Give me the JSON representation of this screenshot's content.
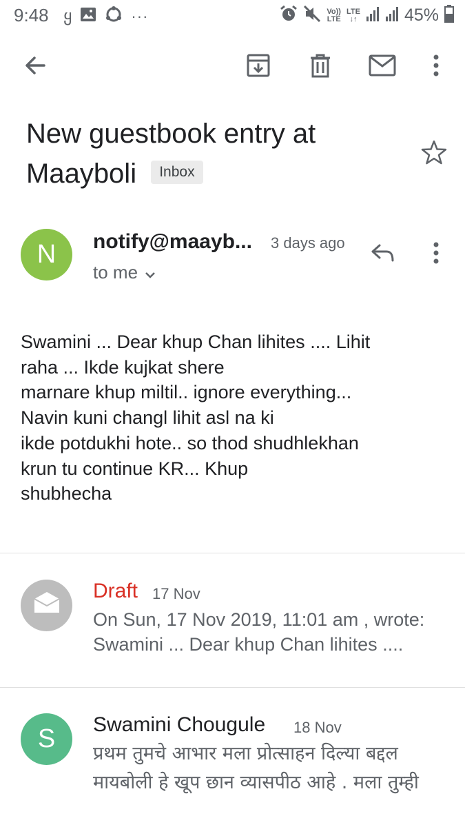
{
  "status_bar": {
    "time": "9:48",
    "notification_glyph": "ყ",
    "more_dots": "···",
    "volte_top": "Vo))",
    "volte_bottom": "LTE",
    "lte_top": "LTE",
    "lte_bottom": "↓↑",
    "battery": "45%"
  },
  "toolbar": {
    "back_icon": "arrow-back",
    "archive_icon": "archive",
    "delete_icon": "trash",
    "mark_unread_icon": "mail",
    "more_icon": "more-vert"
  },
  "subject": {
    "line1": "New guestbook entry at",
    "line2": "Maayboli",
    "label_chip": "Inbox"
  },
  "message": {
    "avatar_letter": "N",
    "avatar_color": "#8bc34a",
    "sender": "notify@maayb...",
    "time": "3 days ago",
    "recipient": "to me",
    "body_lines": [
      "Swamini ... Dear khup Chan lihites .... Lihit",
      "raha ... Ikde kujkat shere",
      "marnare khup miltil.. ignore everything...",
      "Navin kuni changl lihit asl na ki",
      "ikde potdukhi hote.. so thod shudhlekhan",
      "krun tu continue KR... Khup",
      "shubhecha"
    ]
  },
  "draft": {
    "label": "Draft",
    "date": "17 Nov",
    "snippet_line1": "On Sun, 17 Nov 2019, 11:01 am ,  wrote:",
    "snippet_line2": "Swamini ... Dear khup Chan lihites ....",
    "avatar_color": "#bdbdbd"
  },
  "reply": {
    "avatar_letter": "S",
    "avatar_color": "#57bb8a",
    "sender": "Swamini Chougule",
    "date": "18 Nov",
    "snippet_line1": "प्रथम तुमचे आभार मला प्रोत्साहन दिल्या बद्दल",
    "snippet_line2": "मायबोली हे खूप छान व्यासपीठ आहे . मला तुम्ही"
  },
  "colors": {
    "accent_red": "#d93025",
    "icon_gray": "#5f6368"
  }
}
